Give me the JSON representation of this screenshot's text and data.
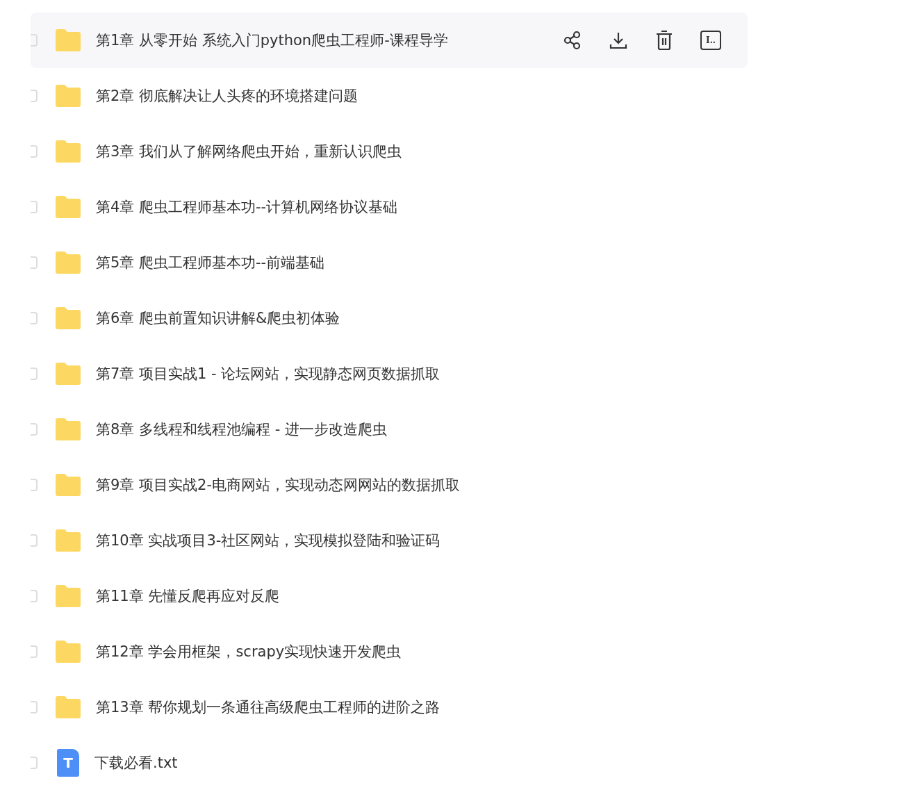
{
  "files": [
    {
      "kind": "folder",
      "name": "第1章 从零开始 系统入门python爬虫工程师-课程导学",
      "highlighted": true
    },
    {
      "kind": "folder",
      "name": "第2章 彻底解决让人头疼的环境搭建问题",
      "highlighted": false
    },
    {
      "kind": "folder",
      "name": "第3章 我们从了解网络爬虫开始，重新认识爬虫",
      "highlighted": false
    },
    {
      "kind": "folder",
      "name": "第4章 爬虫工程师基本功--计算机网络协议基础",
      "highlighted": false
    },
    {
      "kind": "folder",
      "name": "第5章 爬虫工程师基本功--前端基础",
      "highlighted": false
    },
    {
      "kind": "folder",
      "name": "第6章 爬虫前置知识讲解&爬虫初体验",
      "highlighted": false
    },
    {
      "kind": "folder",
      "name": "第7章 项目实战1 - 论坛网站，实现静态网页数据抓取",
      "highlighted": false
    },
    {
      "kind": "folder",
      "name": "第8章 多线程和线程池编程 - 进一步改造爬虫",
      "highlighted": false
    },
    {
      "kind": "folder",
      "name": "第9章 项目实战2-电商网站，实现动态网网站的数据抓取",
      "highlighted": false
    },
    {
      "kind": "folder",
      "name": "第10章 实战项目3-社区网站，实现模拟登陆和验证码",
      "highlighted": false
    },
    {
      "kind": "folder",
      "name": "第11章 先懂反爬再应对反爬",
      "highlighted": false
    },
    {
      "kind": "folder",
      "name": "第12章 学会用框架，scrapy实现快速开发爬虫",
      "highlighted": false
    },
    {
      "kind": "folder",
      "name": "第13章 帮你规划一条通往高级爬虫工程师的进阶之路",
      "highlighted": false
    },
    {
      "kind": "text",
      "name": "下载必看.txt",
      "icon_letter": "T",
      "highlighted": false
    }
  ],
  "rename_icon_text": "I.."
}
